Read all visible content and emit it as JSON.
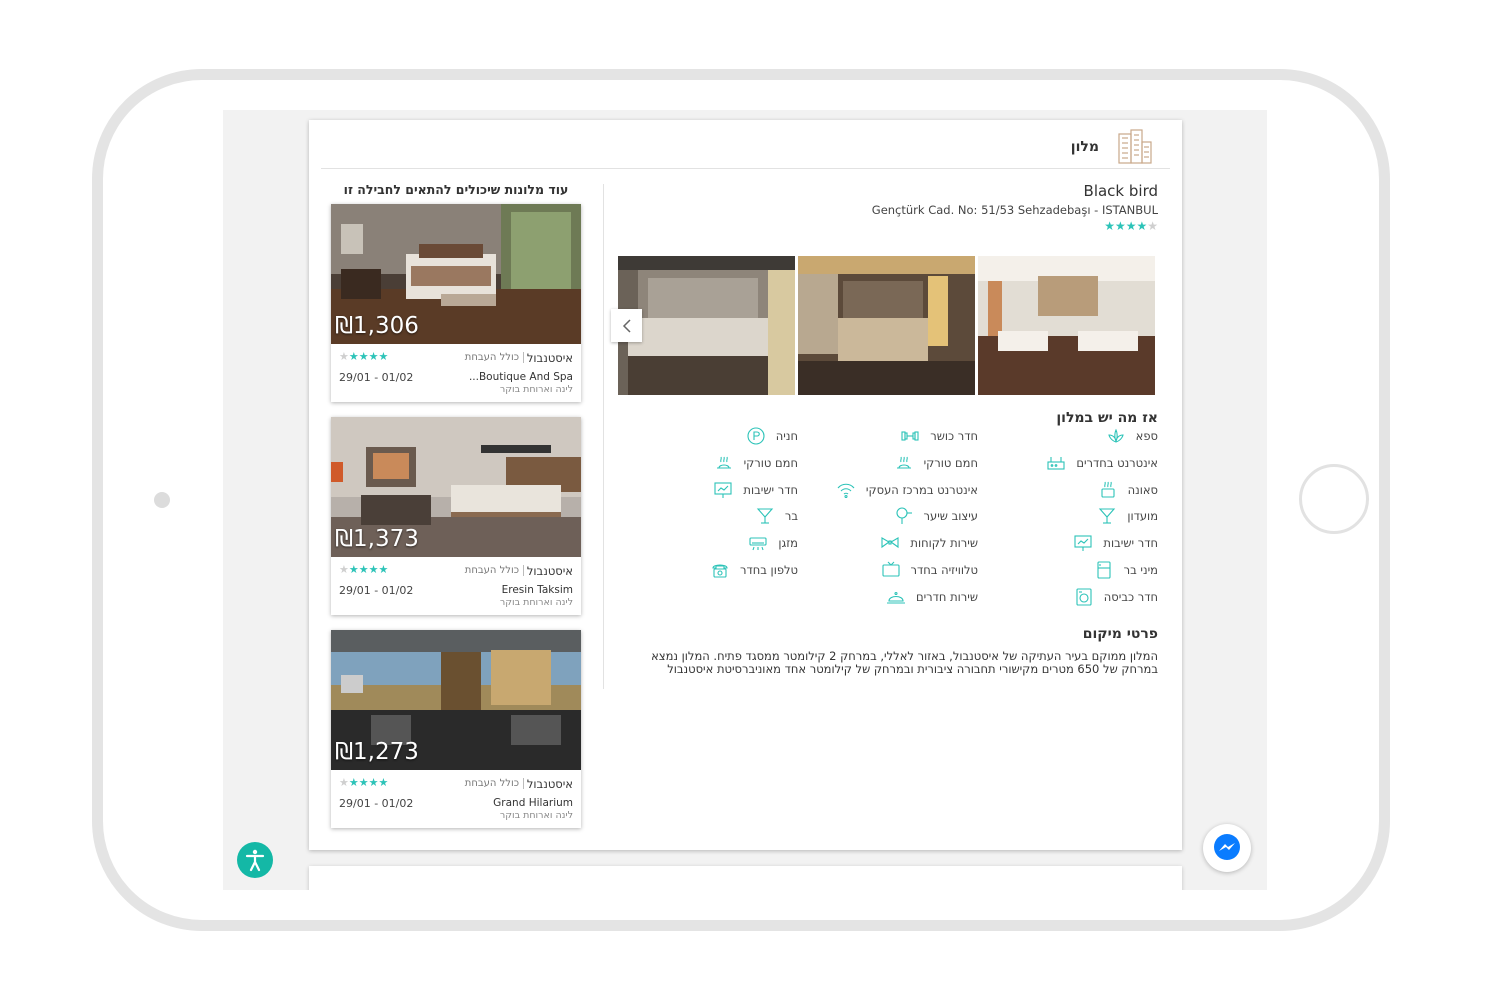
{
  "section": {
    "title": "מלון",
    "icon": "building-icon"
  },
  "sidebar": {
    "title": "עוד מלונות שיכולים להתאים לחבילה זו",
    "hotels": [
      {
        "price": "₪1,306",
        "city": "איסטנבול",
        "includes": "כולל העבחת",
        "name": "...Boutique And Spa",
        "dates": "29/01 - 01/02",
        "board": "לינה וארוחת בוקר",
        "stars": 4
      },
      {
        "price": "₪1,373",
        "city": "איסטנבול",
        "includes": "כולל העבחת",
        "name": "Eresin Taksim",
        "dates": "29/01 - 01/02",
        "board": "לינה וארוחת בוקר",
        "stars": 4
      },
      {
        "price": "₪1,273",
        "city": "איסטנבול",
        "includes": "כולל העבחת",
        "name": "Grand Hilarium",
        "dates": "29/01 - 01/02",
        "board": "לינה וארוחת בוקר",
        "stars": 4
      }
    ]
  },
  "hotel": {
    "name": "Black bird",
    "address": "Gençtürk Cad. No: 51/53 Sehzadebaşı - ISTANBUL",
    "stars": 4
  },
  "amenities": {
    "title": "אז מה יש במלון",
    "items": [
      {
        "label": "ספא",
        "icon": "lotus-icon"
      },
      {
        "label": "אינטרנט בחדרים",
        "icon": "router-icon"
      },
      {
        "label": "סאונה",
        "icon": "sauna-icon"
      },
      {
        "label": "מועדון",
        "icon": "cocktail-icon"
      },
      {
        "label": "חדר ישיבות",
        "icon": "presentation-icon"
      },
      {
        "label": "מיני בר",
        "icon": "fridge-icon"
      },
      {
        "label": "חדר כביסה",
        "icon": "washing-machine-icon"
      },
      {
        "label": "חדר כושר",
        "icon": "dumbbell-icon"
      },
      {
        "label": "חמם טורקי",
        "icon": "steam-icon"
      },
      {
        "label": "אינטרנט במרכז העסקי",
        "icon": "wifi-icon"
      },
      {
        "label": "עיצוב שיער",
        "icon": "hairdryer-icon"
      },
      {
        "label": "שירות לקוחות",
        "icon": "bowtie-icon"
      },
      {
        "label": "טלוויזיה בחדר",
        "icon": "tv-icon"
      },
      {
        "label": "שירות חדרים",
        "icon": "cloche-icon"
      },
      {
        "label": "חניה",
        "icon": "parking-icon"
      },
      {
        "label": "חמם טורקי",
        "icon": "steam-icon"
      },
      {
        "label": "חדר ישיבות",
        "icon": "presentation-icon"
      },
      {
        "label": "בר",
        "icon": "cocktail-icon"
      },
      {
        "label": "מזגן",
        "icon": "air-conditioner-icon"
      },
      {
        "label": "טלפון בחדר",
        "icon": "phone-icon"
      }
    ]
  },
  "location": {
    "title": "פרטי מיקום",
    "text": "המלון ממוקם בעיר העתיקה של איסטנבול, באזור לאללי, במרחק 2 קילומטר ממסגד פתיח. המלון נמצא במרחק של 650 מטרים מקישורי תחבורה ציבורית ובמרחק של קילומטר אחד מאוניברסיטת איסטנבול"
  },
  "colors": {
    "accent": "#2cc3b8",
    "frame": "#e4e4e4"
  }
}
